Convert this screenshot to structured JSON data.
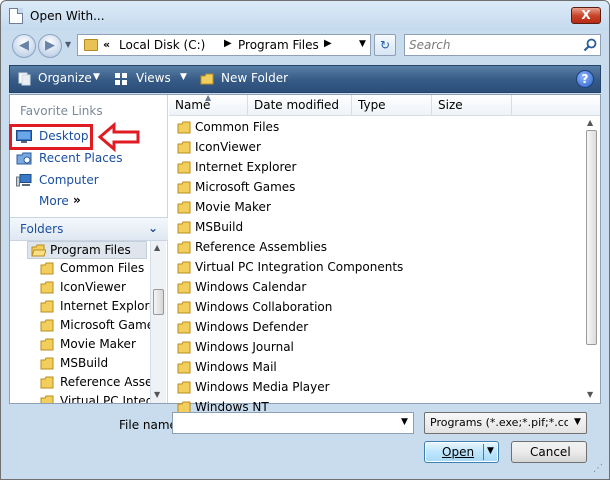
{
  "window": {
    "title": "Open With...",
    "close_label": "X"
  },
  "nav": {
    "breadcrumb_prefix": "«",
    "crumbs": [
      "Local Disk (C:)",
      "Program Files"
    ],
    "search_placeholder": "Search"
  },
  "toolbar": {
    "organize": "Organize",
    "views": "Views",
    "new_folder": "New Folder",
    "help": "?"
  },
  "sidebar": {
    "favorites_header": "Favorite Links",
    "favorites": [
      "Desktop",
      "Recent Places",
      "Computer"
    ],
    "more_label": "More",
    "folders_label": "Folders",
    "tree": [
      "Program Files",
      "Common Files",
      "IconViewer",
      "Internet Explorer",
      "Microsoft Games",
      "Movie Maker",
      "MSBuild",
      "Reference Assemblies",
      "Virtual PC Integration Components"
    ]
  },
  "columns": [
    "Name",
    "Date modified",
    "Type",
    "Size"
  ],
  "files": [
    "Common Files",
    "IconViewer",
    "Internet Explorer",
    "Microsoft Games",
    "Movie Maker",
    "MSBuild",
    "Reference Assemblies",
    "Virtual PC Integration Components",
    "Windows Calendar",
    "Windows Collaboration",
    "Windows Defender",
    "Windows Journal",
    "Windows Mail",
    "Windows Media Player",
    "Windows NT"
  ],
  "bottom": {
    "file_name_label": "File name:",
    "file_name_value": "",
    "file_type": "Programs (*.exe;*.pif;*.com;*.bat;*.cmd)",
    "open_label": "Open",
    "cancel_label": "Cancel"
  },
  "colors": {
    "toolbar": "#355a85",
    "link": "#1a4fa1",
    "highlight": "#e01b22"
  }
}
